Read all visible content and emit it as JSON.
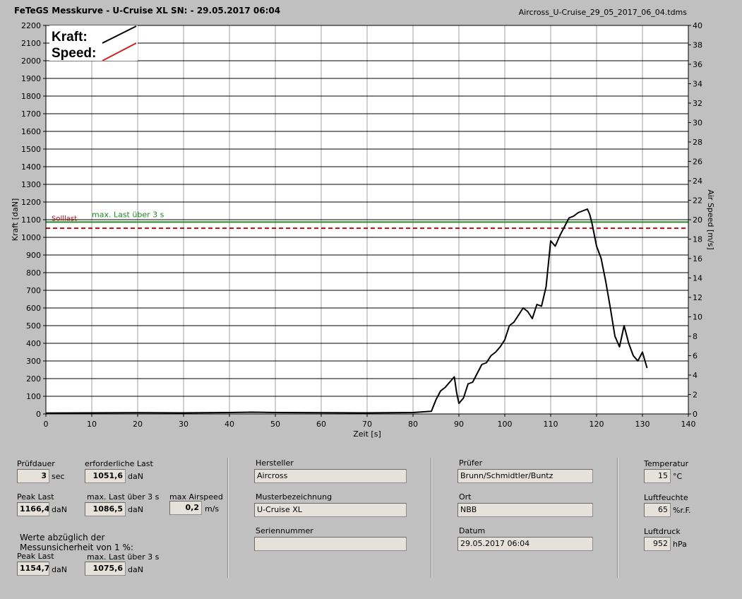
{
  "header": {
    "title": "FeTeGS Messkurve - U-Cruise XL  SN:  - 29.05.2017 06:04",
    "file": "Aircross_U-Cruise_29_05_2017_06_04.tdms"
  },
  "legend": {
    "kraft": "Kraft:",
    "speed": "Speed:"
  },
  "colors": {
    "kraft": "#000000",
    "speed": "#cc2222",
    "max_last": "#228822",
    "solllast": "#aa1111",
    "plot_bg": "#ffffff",
    "grid": "#a0a0a0"
  },
  "chart_data": {
    "type": "line",
    "xlabel": "Zeit [s]",
    "ylabel": "Kraft [daN]",
    "y2label": "Air Speed [m/s]",
    "xlim": [
      0,
      140
    ],
    "ylim": [
      0,
      2200
    ],
    "y2lim": [
      0,
      40
    ],
    "x_ticks": [
      0,
      10,
      20,
      30,
      40,
      50,
      60,
      70,
      80,
      90,
      100,
      110,
      120,
      130,
      140
    ],
    "y_ticks": [
      0,
      100,
      200,
      300,
      400,
      500,
      600,
      700,
      800,
      900,
      1000,
      1100,
      1200,
      1300,
      1400,
      1500,
      1600,
      1700,
      1800,
      1900,
      2000,
      2100,
      2200
    ],
    "y2_ticks": [
      0,
      2,
      4,
      6,
      8,
      10,
      12,
      14,
      16,
      18,
      20,
      22,
      24,
      26,
      28,
      30,
      32,
      34,
      36,
      38,
      40
    ],
    "max_last_line": {
      "value": 1086.5,
      "label": "max. Last über  3 s"
    },
    "solllast_line": {
      "value": 1051.6,
      "label": "Solllast"
    },
    "series": [
      {
        "name": "Kraft",
        "x": [
          0,
          10,
          20,
          30,
          40,
          45,
          50,
          60,
          70,
          80,
          84,
          85,
          86,
          87,
          88,
          89,
          89.5,
          90,
          91,
          92,
          93,
          94,
          95,
          96,
          97,
          98,
          99,
          100,
          101,
          102,
          103,
          104,
          105,
          106,
          107,
          108,
          109,
          110,
          111,
          112,
          113,
          114,
          115,
          116,
          117,
          118,
          118.5,
          119,
          120,
          121,
          122,
          123,
          124,
          125,
          126,
          127,
          128,
          129,
          130,
          131
        ],
        "y": [
          5,
          6,
          7,
          6,
          8,
          10,
          8,
          7,
          6,
          8,
          15,
          80,
          130,
          150,
          180,
          210,
          120,
          60,
          90,
          170,
          180,
          230,
          280,
          290,
          330,
          350,
          380,
          420,
          500,
          520,
          560,
          600,
          580,
          540,
          620,
          610,
          720,
          980,
          950,
          1010,
          1060,
          1110,
          1120,
          1140,
          1150,
          1160,
          1130,
          1080,
          950,
          880,
          750,
          600,
          440,
          380,
          500,
          400,
          330,
          300,
          350,
          260
        ]
      },
      {
        "name": "Speed",
        "x": [
          0,
          131
        ],
        "y": [
          0,
          0
        ]
      }
    ]
  },
  "info": {
    "pruefdauer_label": "Prüfdauer",
    "pruefdauer_value": "3",
    "pruefdauer_unit": "sec",
    "erf_last_label": "erforderliche Last",
    "erf_last_value": "1051,6",
    "erf_last_unit": "daN",
    "peak_label": "Peak Last",
    "peak_value": "1166,4",
    "peak_unit": "daN",
    "maxlast_label": "max. Last über  3 s",
    "maxlast_value": "1086,5",
    "maxlast_unit": "daN",
    "airspeed_label": "max Airspeed",
    "airspeed_value": "0,2",
    "airspeed_unit": "m/s",
    "werte_label_1": "Werte abzüglich der",
    "werte_label_2": "Messunsicherheit von 1  %:",
    "peak2_label": "Peak Last",
    "peak2_value": "1154,7",
    "peak2_unit": "daN",
    "maxlast2_label": "max. Last über  3 s",
    "maxlast2_value": "1075,6",
    "maxlast2_unit": "daN",
    "hersteller_label": "Hersteller",
    "hersteller_value": "Aircross",
    "muster_label": "Musterbezeichnung",
    "muster_value": "U-Cruise XL",
    "serien_label": "Seriennummer",
    "serien_value": "",
    "pruefer_label": "Prüfer",
    "pruefer_value": "Brunn/Schmidtler/Buntz",
    "ort_label": "Ort",
    "ort_value": "NBB",
    "datum_label": "Datum",
    "datum_value": "29.05.2017 06:04",
    "temp_label": "Temperatur",
    "temp_value": "15",
    "temp_unit": "°C",
    "feuchte_label": "Luftfeuchte",
    "feuchte_value": "65",
    "feuchte_unit": "%r.F.",
    "druck_label": "Luftdruck",
    "druck_value": "952",
    "druck_unit": "hPa"
  }
}
